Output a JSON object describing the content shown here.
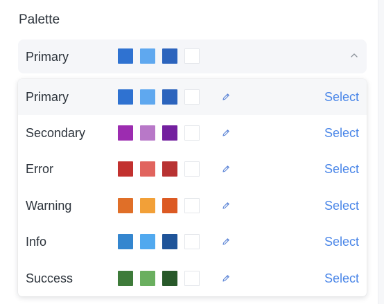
{
  "section_title": "Palette",
  "selected": {
    "label": "Primary",
    "colors": [
      "#2f72d1",
      "#5fa8ef",
      "#2c64bd",
      "#ffffff"
    ],
    "chevron_icon": "chevron-up-icon"
  },
  "options": [
    {
      "name": "Primary",
      "colors": [
        "#2f72d1",
        "#5fa8ef",
        "#2c64bd",
        "#ffffff"
      ],
      "edit_icon": "pencil-icon",
      "action": "Select",
      "highlighted": true
    },
    {
      "name": "Secondary",
      "colors": [
        "#9c2cb0",
        "#b878c8",
        "#73209f",
        "#ffffff"
      ],
      "edit_icon": "pencil-icon",
      "action": "Select",
      "highlighted": false
    },
    {
      "name": "Error",
      "colors": [
        "#c2312f",
        "#e1645e",
        "#b83232",
        "#ffffff"
      ],
      "edit_icon": "pencil-icon",
      "action": "Select",
      "highlighted": false
    },
    {
      "name": "Warning",
      "colors": [
        "#e06f28",
        "#f2a038",
        "#dc5a23",
        "#ffffff"
      ],
      "edit_icon": "pencil-icon",
      "action": "Select",
      "highlighted": false
    },
    {
      "name": "Info",
      "colors": [
        "#3486cf",
        "#51a9ef",
        "#1f5499",
        "#ffffff"
      ],
      "edit_icon": "pencil-icon",
      "action": "Select",
      "highlighted": false
    },
    {
      "name": "Success",
      "colors": [
        "#3e7b3a",
        "#6aaf5f",
        "#28592a",
        "#ffffff"
      ],
      "edit_icon": "pencil-icon",
      "action": "Select",
      "highlighted": false
    }
  ],
  "accent_color": "#4a86e8"
}
